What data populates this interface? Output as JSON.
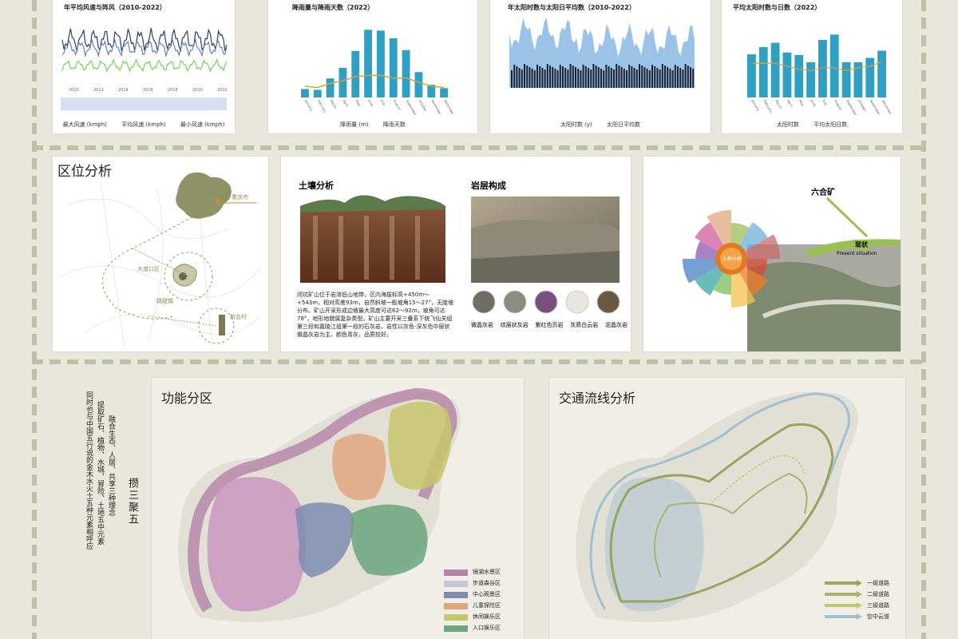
{
  "charts": {
    "wind": {
      "title": "年平均风速与阵风（2010-2022）",
      "legend": [
        "最大风速 (kmph)",
        "平均风速 (kmph)",
        "最小风速 (kmph)"
      ],
      "years": [
        "2010",
        "2012",
        "2014",
        "2016",
        "2018",
        "2020",
        "2022"
      ]
    },
    "rain": {
      "title": "降雨量与降雨天数（2022）",
      "legend": [
        "降雨量 (m)",
        "降雨天数"
      ],
      "ylabel_left": "降雨天数"
    },
    "sun": {
      "title": "年太阳时数与太阳日平均数（2010-2022）",
      "legend": [
        "太阳时数 (y)",
        "太阳日平均数"
      ]
    },
    "sunavg": {
      "title": "平均太阳时数与日数（2022）",
      "legend": [
        "太阳时数",
        "平均太阳日数"
      ]
    }
  },
  "chart_data": [
    {
      "type": "bar",
      "title": "降雨量与降雨天数（2022）",
      "categories": [
        "January",
        "February",
        "March",
        "April",
        "May",
        "June",
        "July",
        "August",
        "September",
        "October",
        "November",
        "December"
      ],
      "series": [
        {
          "name": "降雨量 (m)",
          "values": [
            20,
            18,
            45,
            70,
            110,
            160,
            158,
            140,
            112,
            60,
            30,
            22
          ]
        },
        {
          "name": "降雨天数",
          "values": [
            6,
            5,
            8,
            10,
            13,
            14,
            14,
            12,
            12,
            9,
            6,
            5
          ]
        }
      ]
    },
    {
      "type": "bar",
      "title": "平均太阳时数与日数（2022）",
      "categories": [
        "January",
        "February",
        "March",
        "April",
        "May",
        "June",
        "July",
        "August",
        "September",
        "October",
        "November",
        "December"
      ],
      "series": [
        {
          "name": "太阳时数",
          "values": [
            120,
            140,
            152,
            125,
            118,
            98,
            160,
            175,
            98,
            98,
            110,
            130
          ]
        },
        {
          "name": "平均太阳日数",
          "values": [
            23,
            23,
            23,
            21,
            19,
            18,
            20,
            20,
            18,
            20,
            21,
            24
          ]
        }
      ]
    }
  ],
  "location": {
    "title": "区位分析",
    "labels": [
      "中国·重庆市",
      "大渡口区",
      "跳磴镇",
      "新合村"
    ]
  },
  "soil": {
    "title": "土壤分析",
    "rock_title": "岩层构成",
    "desc": "闭坑矿山位于岩溶低山地带，区内海拔标高+450m～+543m，相对高差93m，自然斜坡一般坡角15～27°，无陡坡分布。矿山开采形成边坡最大高度可达62～92m，坡角可达78°，地形地貌属复杂类型。矿山主要开采三叠系下统飞仙关组第三段和嘉陵江组第一段的石灰岩，岩性以灰色-深灰色中层状微晶灰岩为主，颜色青灰，品质较好。",
    "rocks": [
      "微晶灰岩",
      "纹层状灰岩",
      "紫红色页岩",
      "灰质白云岩",
      "泥晶灰岩"
    ]
  },
  "status": {
    "title": "现状",
    "subtitle": "Present situation",
    "place": "六合矿",
    "center": "人群分析"
  },
  "concept": {
    "title": "攒三聚五",
    "text1": "融合生态、人居、共享三种理念",
    "text2": "提取矿石、植物、水城、冒险、土地五中元素",
    "text3": "同时也与中国五行说的金木水火土五种元素相呼应"
  },
  "func": {
    "title": "功能分区",
    "legend": [
      "镜湖水景区",
      "步道森谷区",
      "中心观景区",
      "儿童探险区",
      "休闲娱乐区",
      "入口娱乐区"
    ],
    "colors": [
      "#b482a8",
      "#c9c3d6",
      "#7c8db0",
      "#e0a77e",
      "#c6c76a",
      "#6aa67e"
    ]
  },
  "traffic": {
    "title": "交通流线分析",
    "legend": [
      "一级道路",
      "二级道路",
      "三级道路",
      "空中云道"
    ],
    "colors": [
      "#97a35f",
      "#a8b36e",
      "#c4c56c",
      "#9fc0d0"
    ]
  }
}
